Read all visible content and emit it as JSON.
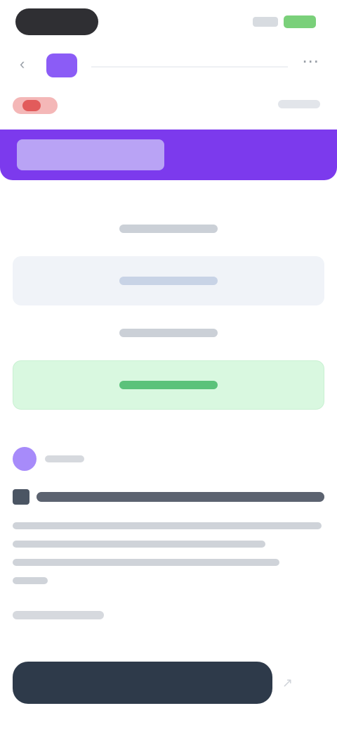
{
  "status": {
    "time": "",
    "battery_color": "#7ad07a"
  },
  "nav": {
    "back_icon": "chevron-left-icon",
    "more_icon": "more-icon",
    "brand_color": "#8b5cf6"
  },
  "banner": {
    "label": "",
    "color": "#7c3aed"
  },
  "options": [
    {
      "label": ""
    },
    {
      "label": ""
    },
    {
      "label": ""
    },
    {
      "label": ""
    }
  ],
  "post": {
    "author": "",
    "headline": "",
    "meta": ""
  },
  "cta": {
    "label": ""
  }
}
